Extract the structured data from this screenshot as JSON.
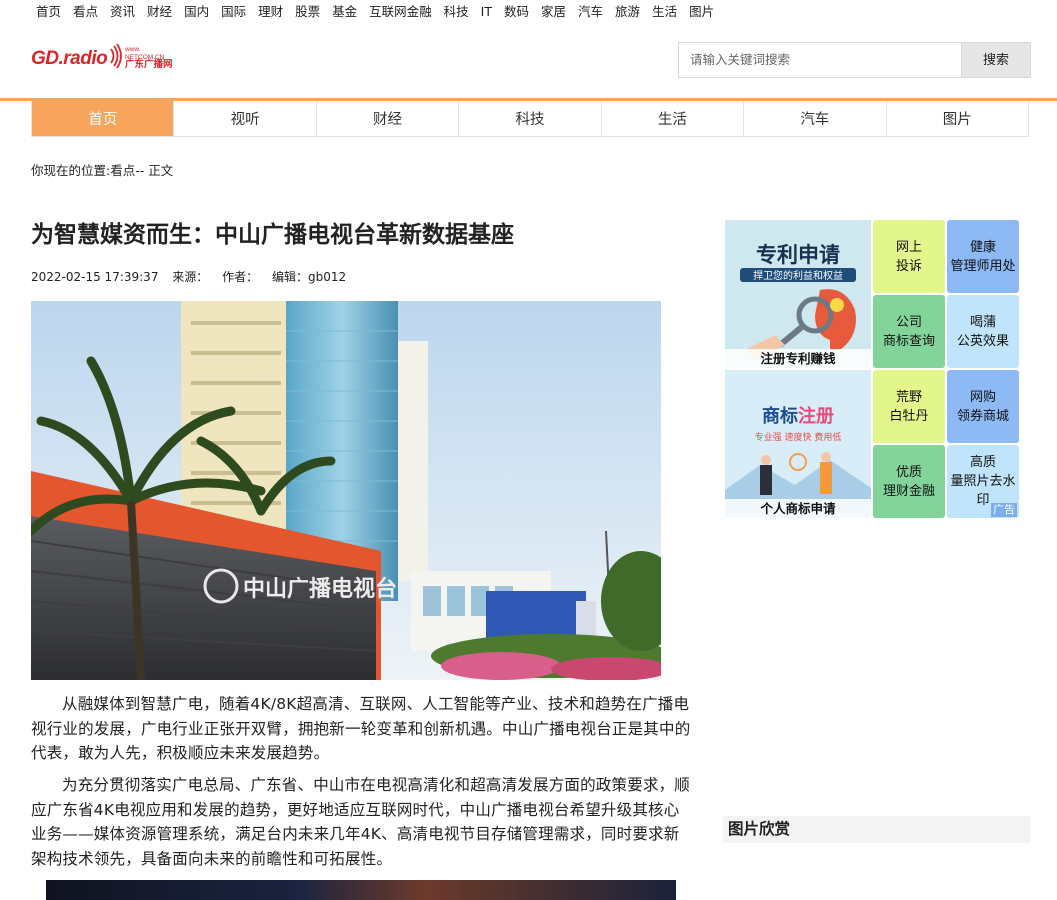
{
  "top_nav": [
    "首页",
    "看点",
    "资讯",
    "财经",
    "国内",
    "国际",
    "理财",
    "股票",
    "基金",
    "互联网金融",
    "科技",
    "IT",
    "数码",
    "家居",
    "汽车",
    "旅游",
    "生活",
    "图片"
  ],
  "logo": {
    "gd": "GD.radio",
    "site": "www.\nNETCOM.CN",
    "cn": "广东广播网"
  },
  "search": {
    "placeholder": "请输入关键词搜索",
    "button": "搜索"
  },
  "main_nav": {
    "items": [
      "首页",
      "视听",
      "财经",
      "科技",
      "生活",
      "汽车",
      "图片"
    ],
    "active": "首页"
  },
  "breadcrumb": "你现在的位置:看点-- 正文",
  "article": {
    "title": "为智慧媒资而生：中山广播电视台革新数据基座",
    "date": "2022-02-15 17:39:37",
    "source_label": "来源：",
    "author_label": "作者：",
    "editor": "编辑：gb012",
    "hero_sign": "中山广播电视台",
    "paragraphs": [
      "从融媒体到智慧广电，随着4K/8K超高清、互联网、人工智能等产业、技术和趋势在广播电视行业的发展，广电行业正张开双臂，拥抱新一轮变革和创新机遇。中山广播电视台正是其中的代表，敢为人先，积极顺应未来发展趋势。",
      "为充分贯彻落实广电总局、广东省、中山市在电视高清化和超高清发展方面的政策要求，顺应广东省4K电视应用和发展的趋势，更好地适应互联网时代，中山广播电视台希望升级其核心业务——媒体资源管理系统，满足台内未来几年4K、高清电视节目存储管理需求，同时要求新架构技术领先，具备面向未来的前瞻性和可拓展性。"
    ]
  },
  "ads": {
    "patent": {
      "title": "专利申请",
      "sub": "捍卫您的利益和权益",
      "caption": "注册专利赚钱"
    },
    "trademark": {
      "title1": "商标",
      "title2": "注册",
      "sub": "专业强  速度快  费用低",
      "caption": "个人商标申请"
    },
    "tiles": [
      {
        "l1": "网上",
        "l2": "投诉",
        "color": "#e3f68c"
      },
      {
        "l1": "健康",
        "l2": "管理师用处",
        "color": "#8db9f5"
      },
      {
        "l1": "公司",
        "l2": "商标查询",
        "color": "#82d49a"
      },
      {
        "l1": "喝蒲",
        "l2": "公英效果",
        "color": "#bfe4fb"
      },
      {
        "l1": "荒野",
        "l2": "白牡丹",
        "color": "#e3f68c"
      },
      {
        "l1": "网购",
        "l2": "领券商城",
        "color": "#8db9f5"
      },
      {
        "l1": "优质",
        "l2": "理财金融",
        "color": "#82d49a"
      },
      {
        "l1": "高质",
        "l2": "量照片去水印",
        "color": "#bfe4fb"
      }
    ],
    "tag": "广告"
  },
  "sidebar": {
    "pictures_heading": "图片欣赏"
  }
}
